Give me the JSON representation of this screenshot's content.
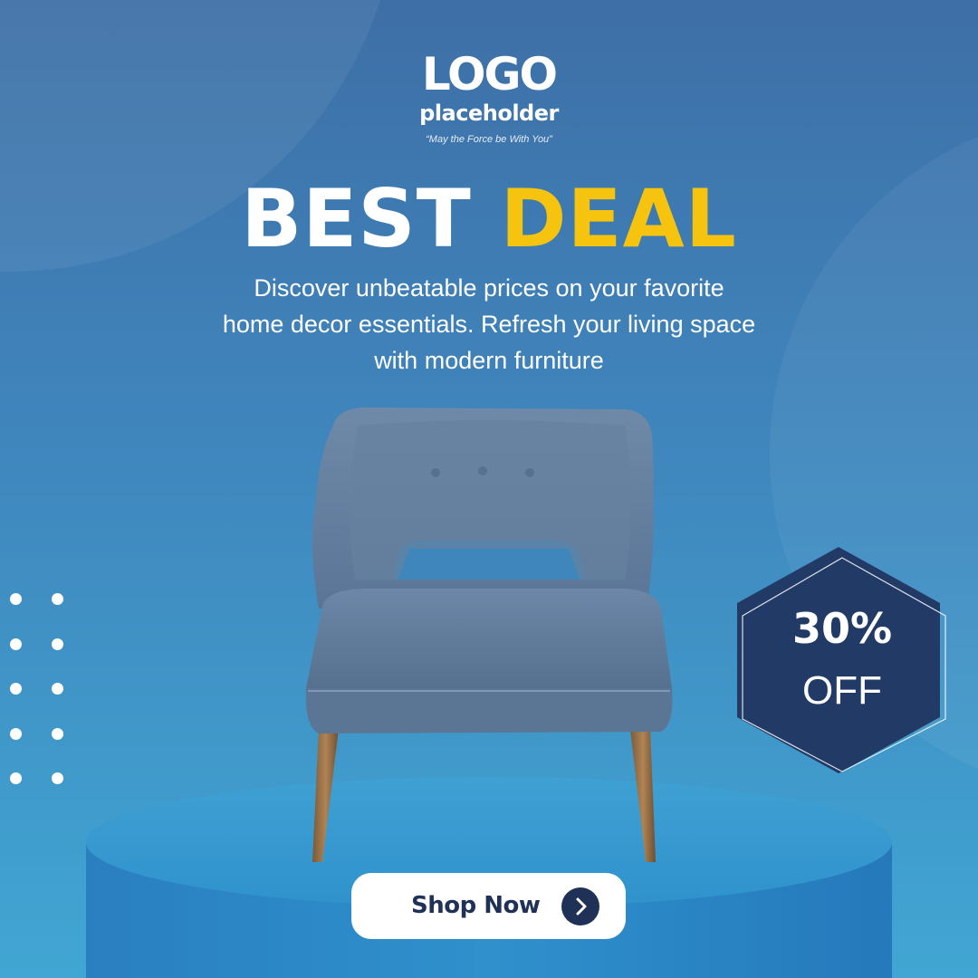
{
  "logo": {
    "main": "LOGO",
    "sub": "placeholder",
    "tagline": "“May the Force be With You”"
  },
  "headline": {
    "word1": "BEST",
    "word2": "DEAL"
  },
  "description": {
    "line1": "Discover unbeatable prices on your favorite",
    "line2": "home decor essentials. Refresh your living space",
    "line3": "with modern furniture"
  },
  "badge": {
    "percent": "30%",
    "label": "OFF"
  },
  "cta": {
    "label": "Shop Now",
    "icon": "chevron-right-icon"
  },
  "colors": {
    "accent_yellow": "#f6c40e",
    "navy": "#1f3157",
    "badge_fill": "#223a66",
    "background_top": "#3e6fa6",
    "background_bottom": "#41a6d3"
  }
}
